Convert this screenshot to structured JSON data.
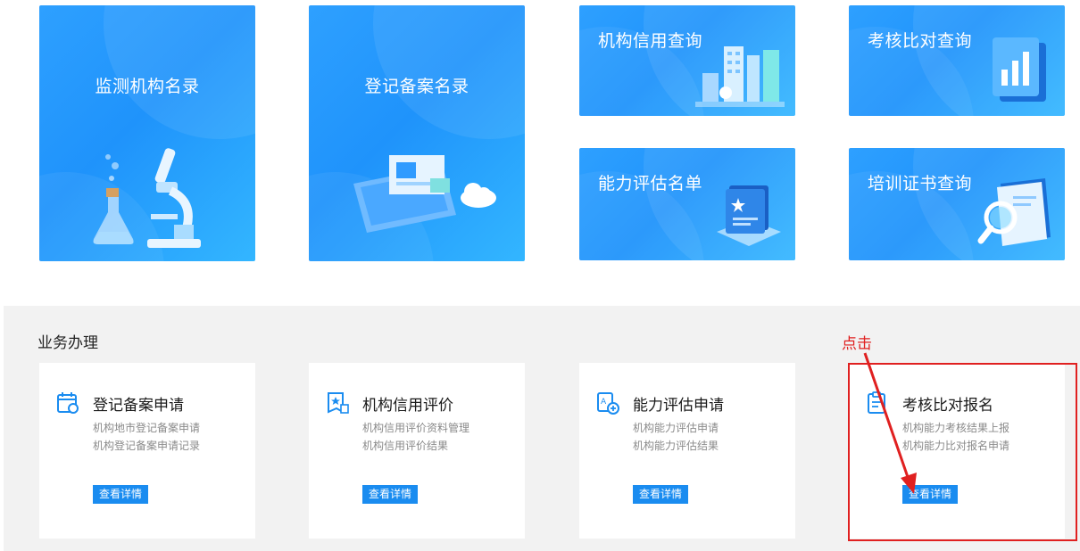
{
  "tiles": [
    {
      "title": "监测机构名录"
    },
    {
      "title": "登记备案名录"
    },
    {
      "title": "机构信用查询"
    },
    {
      "title": "考核比对查询"
    },
    {
      "title": "能力评估名单"
    },
    {
      "title": "培训证书查询"
    }
  ],
  "section": {
    "title": "业务办理",
    "cards": [
      {
        "title": "登记备案申请",
        "line1": "机构地市登记备案申请",
        "line2": "机构登记备案申请记录",
        "button": "查看详情"
      },
      {
        "title": "机构信用评价",
        "line1": "机构信用评价资料管理",
        "line2": "机构信用评价结果",
        "button": "查看详情"
      },
      {
        "title": "能力评估申请",
        "line1": "机构能力评估申请",
        "line2": "机构能力评估结果",
        "button": "查看详情"
      },
      {
        "title": "考核比对报名",
        "line1": "机构能力考核结果上报",
        "line2": "机构能力比对报名申请",
        "button": "查看详情"
      }
    ]
  },
  "annotation": {
    "label": "点击",
    "color": "#e02020"
  },
  "colors": {
    "accent": "#1a8cf0",
    "tile_bg": "#1f93fb",
    "section_bg": "#f2f2f2"
  }
}
